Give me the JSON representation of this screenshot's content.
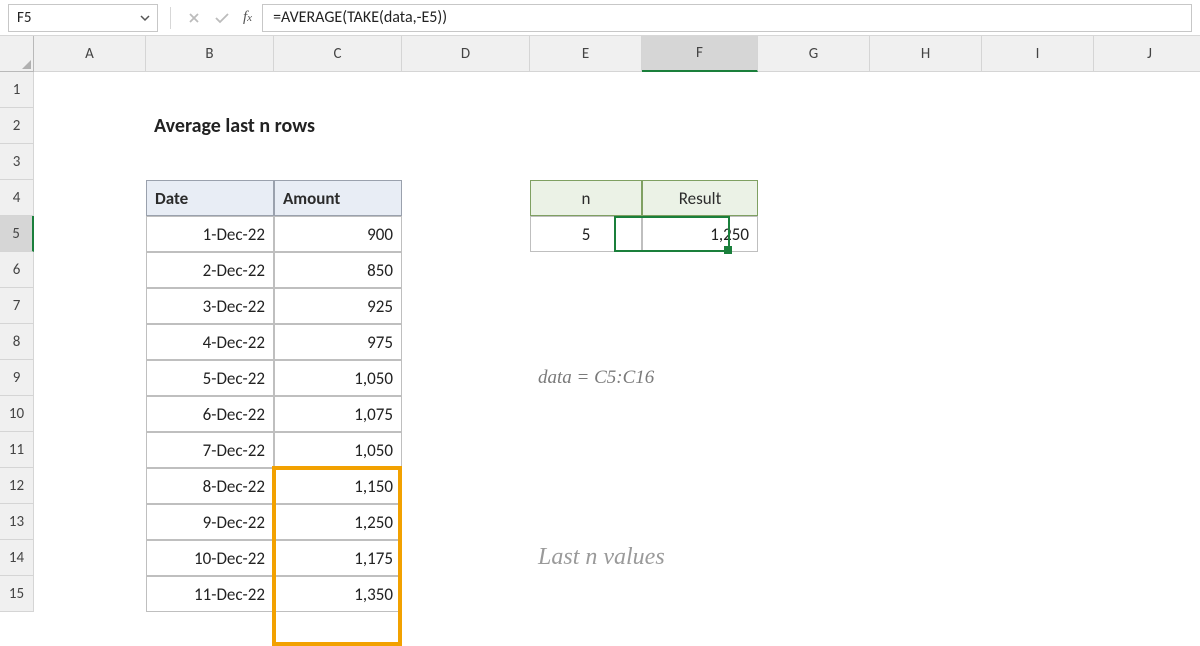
{
  "namebox": {
    "value": "F5"
  },
  "formula_bar": {
    "value": "=AVERAGE(TAKE(data,-E5))"
  },
  "columns": [
    "A",
    "B",
    "C",
    "D",
    "E",
    "F",
    "G",
    "H",
    "I",
    "J"
  ],
  "rows": [
    "1",
    "2",
    "3",
    "4",
    "5",
    "6",
    "7",
    "8",
    "9",
    "10",
    "11",
    "12",
    "13",
    "14",
    "15"
  ],
  "title": "Average last n rows",
  "data_table": {
    "headers": {
      "date": "Date",
      "amount": "Amount"
    },
    "rows": [
      {
        "date": "1-Dec-22",
        "amount": "900"
      },
      {
        "date": "2-Dec-22",
        "amount": "850"
      },
      {
        "date": "3-Dec-22",
        "amount": "925"
      },
      {
        "date": "4-Dec-22",
        "amount": "975"
      },
      {
        "date": "5-Dec-22",
        "amount": "1,050"
      },
      {
        "date": "6-Dec-22",
        "amount": "1,075"
      },
      {
        "date": "7-Dec-22",
        "amount": "1,050"
      },
      {
        "date": "8-Dec-22",
        "amount": "1,150"
      },
      {
        "date": "9-Dec-22",
        "amount": "1,250"
      },
      {
        "date": "10-Dec-22",
        "amount": "1,175"
      },
      {
        "date": "11-Dec-22",
        "amount": "1,350"
      }
    ]
  },
  "result_table": {
    "headers": {
      "n": "n",
      "result": "Result"
    },
    "row": {
      "n": "5",
      "result": "1,250"
    }
  },
  "annotations": {
    "range_def": "data = C5:C16",
    "last_n": "Last n values"
  },
  "selected_cell": "F5",
  "highlight_range": "C12:C15"
}
